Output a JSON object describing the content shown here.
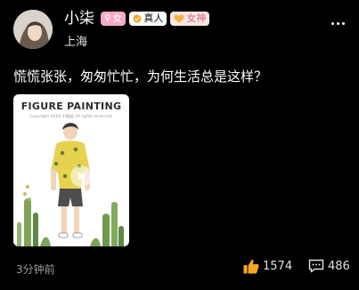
{
  "user": {
    "name": "小柒",
    "location": "上海",
    "badges": [
      {
        "icon": "female-icon",
        "label": "女"
      },
      {
        "icon": "verified-icon",
        "label": "真人"
      },
      {
        "icon": "heart-icon",
        "label": "女神"
      }
    ]
  },
  "post": {
    "text": "慌慌张张，匆匆忙忙，为何生活总是这样？",
    "media": {
      "title": "FIGURE PAINTING",
      "copyright": "Copyright 2018 小插画 All rights reserved.",
      "type": "video"
    }
  },
  "footer": {
    "time": "3分钟前",
    "likes": "1574",
    "comments": "486"
  },
  "colors": {
    "background": "#000000",
    "gender_badge": "#f7a9c7",
    "goddess_badge": "#fbe6e2",
    "muted_text": "#9a9a9a"
  }
}
